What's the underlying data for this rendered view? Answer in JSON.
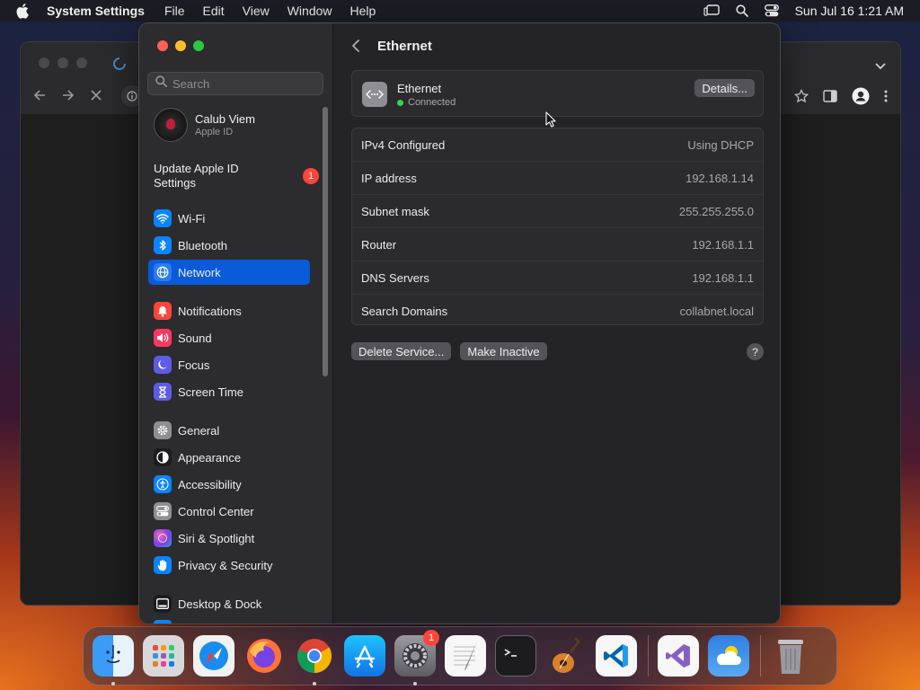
{
  "menubar": {
    "app_name": "System Settings",
    "menus": [
      "File",
      "Edit",
      "View",
      "Window",
      "Help"
    ],
    "clock": "Sun Jul 16  1:21 AM"
  },
  "sidebar": {
    "search_placeholder": "Search",
    "profile": {
      "name": "Calub Viem",
      "subtitle": "Apple ID"
    },
    "update": {
      "label": "Update Apple ID Settings",
      "badge": "1"
    },
    "items": [
      {
        "label": "Wi-Fi",
        "color": "#0a84ff"
      },
      {
        "label": "Bluetooth",
        "color": "#0a84ff"
      },
      {
        "label": "Network",
        "color": "#0a84ff",
        "active": true
      },
      {
        "label": "Notifications",
        "color": "#ff453a"
      },
      {
        "label": "Sound",
        "color": "#ff375f"
      },
      {
        "label": "Focus",
        "color": "#5e5ce6"
      },
      {
        "label": "Screen Time",
        "color": "#5e5ce6"
      },
      {
        "label": "General",
        "color": "#8e8e93"
      },
      {
        "label": "Appearance",
        "color": "#1c1c1e"
      },
      {
        "label": "Accessibility",
        "color": "#0a84ff"
      },
      {
        "label": "Control Center",
        "color": "#8e8e93"
      },
      {
        "label": "Siri & Spotlight",
        "color": "#bf5af2"
      },
      {
        "label": "Privacy & Security",
        "color": "#0a84ff"
      },
      {
        "label": "Desktop & Dock",
        "color": "#1c1c1e"
      }
    ]
  },
  "main": {
    "title": "Ethernet",
    "service": {
      "name": "Ethernet",
      "status": "Connected",
      "details_label": "Details..."
    },
    "rows": [
      {
        "label": "IPv4 Configured",
        "value": "Using DHCP"
      },
      {
        "label": "IP address",
        "value": "192.168.1.14"
      },
      {
        "label": "Subnet mask",
        "value": "255.255.255.0"
      },
      {
        "label": "Router",
        "value": "192.168.1.1"
      },
      {
        "label": "DNS Servers",
        "value": "192.168.1.1"
      },
      {
        "label": "Search Domains",
        "value": "collabnet.local"
      }
    ],
    "delete_label": "Delete Service...",
    "inactive_label": "Make Inactive",
    "help_label": "?"
  },
  "dock": {
    "apps": [
      "finder",
      "launchpad",
      "safari",
      "firefox",
      "chrome",
      "app-store",
      "system-settings",
      "textedit",
      "terminal",
      "garageband",
      "vscode",
      "visual-studio",
      "weather",
      "trash"
    ],
    "system_settings_badge": "1"
  }
}
